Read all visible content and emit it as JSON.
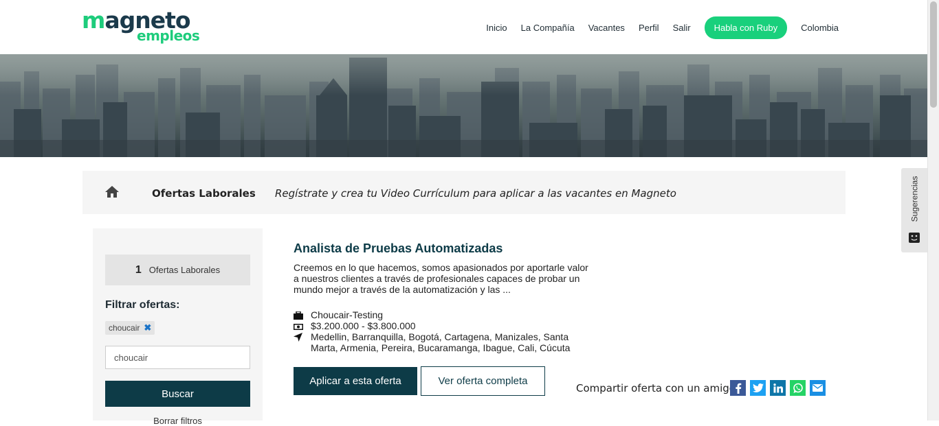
{
  "brand": {
    "logo_main": "magneto",
    "logo_sub": "empleos",
    "green": "#1ecc7c",
    "navy": "#0d3b47"
  },
  "nav": {
    "items": [
      "Inicio",
      "La Compañía",
      "Vacantes",
      "Perfil",
      "Salir"
    ],
    "ruby_button": "Habla con Ruby",
    "country": "Colombia"
  },
  "suggestions": {
    "label": "Sugerencias",
    "icon": "smile-box-icon"
  },
  "breadcrumb": {
    "home_icon": "home-icon",
    "title": "Ofertas Laborales",
    "note": "Regístrate y crea tu Video Currículum para aplicar a las vacantes en Magneto"
  },
  "sidebar": {
    "count": "1",
    "count_label": "Ofertas Laborales",
    "filter_title": "Filtrar ofertas:",
    "chip": "choucair",
    "search_value": "choucair",
    "search_button": "Buscar",
    "clear_link": "Borrar filtros"
  },
  "job": {
    "title": "Analista de Pruebas Automatizadas",
    "description": "Creemos en lo que hacemos, somos apasionados por aportarle valor a nuestros clientes a través de profesionales capaces de probar un mundo mejor a través de la automatización y las ...",
    "company": "Choucair-Testing",
    "salary": "$3.200.000 - $3.800.000",
    "locations": "Medellin, Barranquilla, Bogotá, Cartagena, Manizales, Santa Marta, Armenia, Pereira, Bucaramanga, Ibague, Cali, Cúcuta",
    "apply_button": "Aplicar a esta oferta",
    "view_button": "Ver oferta completa",
    "share_label": "Compartir oferta con un amigo",
    "share_icons": [
      {
        "name": "facebook-icon",
        "color": "#3b5998"
      },
      {
        "name": "twitter-icon",
        "color": "#1da1f2"
      },
      {
        "name": "linkedin-icon",
        "color": "#0e76a8"
      },
      {
        "name": "whatsapp-icon",
        "color": "#25d366"
      },
      {
        "name": "email-icon",
        "color": "#1a8fe3"
      }
    ]
  }
}
